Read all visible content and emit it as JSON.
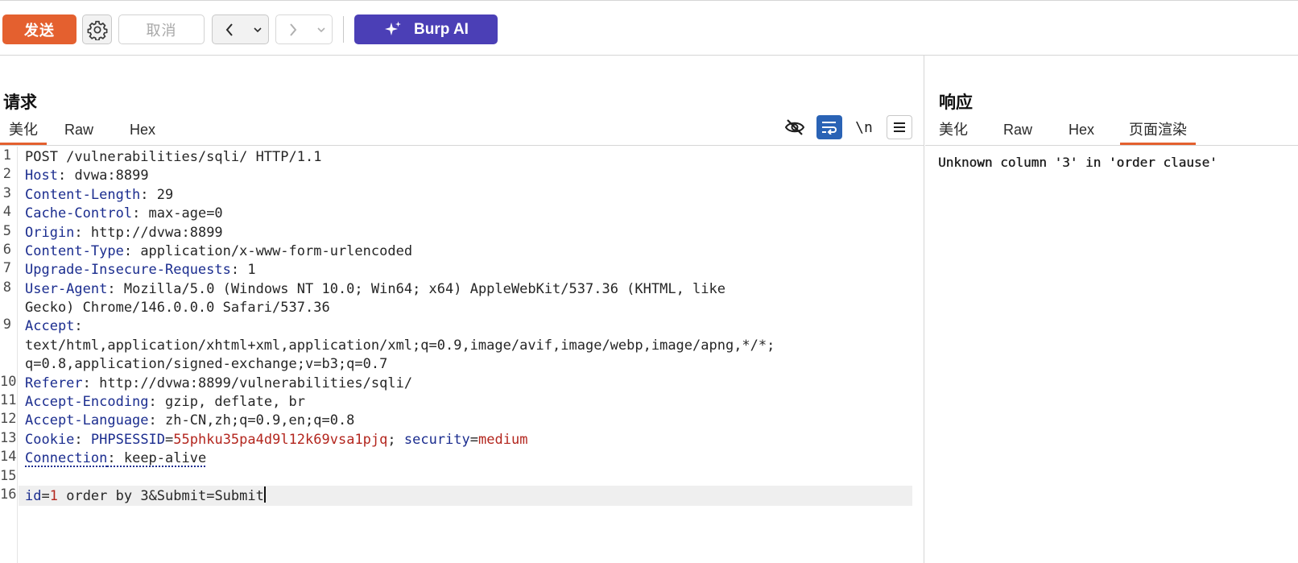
{
  "toolbar": {
    "send_label": "发送",
    "cancel_label": "取消",
    "burp_ai_label": "Burp AI",
    "icons": {
      "settings": "gear-icon",
      "back": "chevron-left-icon",
      "forward": "chevron-right-icon",
      "dropdown": "chevron-down-icon",
      "ai": "sparkle-icon"
    }
  },
  "colors": {
    "send_button": "#e4602f",
    "burp_ai_button": "#4b3fb6",
    "active_tab_underline": "#e4602f",
    "header_key": "#1b2d8f",
    "param_value": "#b3261e",
    "wrap_toggle": "#2a63b5"
  },
  "request": {
    "title": "请求",
    "tabs": [
      {
        "label": "美化",
        "active": true
      },
      {
        "label": "Raw",
        "active": false
      },
      {
        "label": "Hex",
        "active": false
      }
    ],
    "tools": {
      "hide_icon": "eye-slash-icon",
      "wrap_icon": "wrap-lines-icon",
      "newline_label": "\\n",
      "menu_icon": "hamburger-menu-icon"
    },
    "line_numbers": [
      "1",
      "2",
      "3",
      "4",
      "5",
      "6",
      "7",
      "8",
      "9",
      "10",
      "11",
      "12",
      "13",
      "14",
      "15",
      "16"
    ],
    "request_line": "POST /vulnerabilities/sqli/ HTTP/1.1",
    "headers": [
      {
        "key": "Host",
        "value": "dvwa:8899"
      },
      {
        "key": "Content-Length",
        "value": "29"
      },
      {
        "key": "Cache-Control",
        "value": "max-age=0"
      },
      {
        "key": "Origin",
        "value": "http://dvwa:8899"
      },
      {
        "key": "Content-Type",
        "value": "application/x-www-form-urlencoded"
      },
      {
        "key": "Upgrade-Insecure-Requests",
        "value": "1"
      },
      {
        "key": "User-Agent",
        "value": "Mozilla/5.0 (Windows NT 10.0; Win64; x64) AppleWebKit/537.36 (KHTML, like",
        "value_cont": "Gecko) Chrome/146.0.0.0 Safari/537.36"
      },
      {
        "key": "Accept",
        "value": "",
        "value_cont": "text/html,application/xhtml+xml,application/xml;q=0.9,image/avif,image/webp,image/apng,*/*;",
        "value_cont2": "q=0.8,application/signed-exchange;v=b3;q=0.7"
      },
      {
        "key": "Referer",
        "value": "http://dvwa:8899/vulnerabilities/sqli/"
      },
      {
        "key": "Accept-Encoding",
        "value": "gzip, deflate, br"
      },
      {
        "key": "Accept-Language",
        "value": "zh-CN,zh;q=0.9,en;q=0.8"
      },
      {
        "key": "Cookie",
        "cookies": [
          {
            "name": "PHPSESSID",
            "value": "55phku35pa4d9l12k69vsa1pjq"
          },
          {
            "name": "security",
            "value": "medium"
          }
        ]
      },
      {
        "key": "Connection",
        "value": "keep-alive"
      }
    ],
    "body": {
      "param1_name": "id",
      "param1_value": "1",
      "rest": " order by 3&Submit=Submit"
    }
  },
  "response": {
    "title": "响应",
    "tabs": [
      {
        "label": "美化",
        "active": false
      },
      {
        "label": "Raw",
        "active": false
      },
      {
        "label": "Hex",
        "active": false
      },
      {
        "label": "页面渲染",
        "active": true
      }
    ],
    "rendered_text": "Unknown column '3' in 'order clause'"
  }
}
